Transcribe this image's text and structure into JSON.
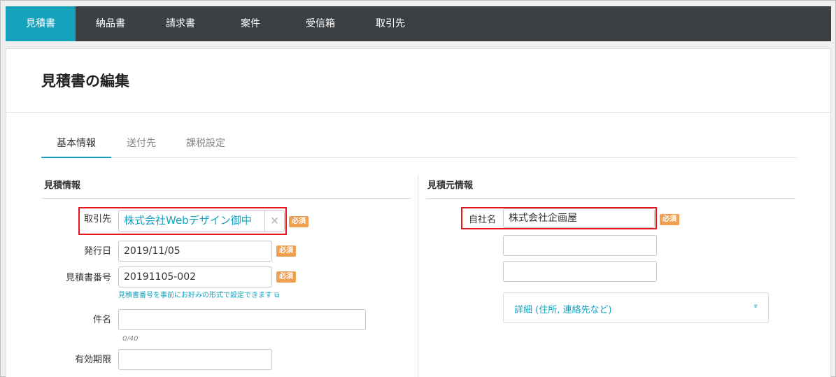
{
  "nav": {
    "items": [
      {
        "label": "見積書",
        "active": true
      },
      {
        "label": "納品書",
        "active": false
      },
      {
        "label": "請求書",
        "active": false
      },
      {
        "label": "案件",
        "active": false
      },
      {
        "label": "受信箱",
        "active": false
      },
      {
        "label": "取引先",
        "active": false
      }
    ]
  },
  "page": {
    "title": "見積書の編集"
  },
  "tabs": [
    {
      "label": "基本情報",
      "active": true
    },
    {
      "label": "送付先",
      "active": false
    },
    {
      "label": "課税設定",
      "active": false
    }
  ],
  "left": {
    "section_title": "見積情報",
    "client": {
      "label": "取引先",
      "value": "株式会社Webデザイン御中",
      "clear_icon": "×"
    },
    "issue_date": {
      "label": "発行日",
      "value": "2019/11/05"
    },
    "estimate_number": {
      "label": "見積書番号",
      "value": "20191105-002",
      "hint": "見積書番号を事前にお好みの形式で設定できます",
      "hint_icon": "⧉"
    },
    "subject": {
      "label": "件名",
      "value": "",
      "counter": "0/40"
    },
    "expiry": {
      "label": "有効期限",
      "value": ""
    }
  },
  "right": {
    "section_title": "見積元情報",
    "company": {
      "label": "自社名",
      "value": "株式会社企画屋"
    },
    "extra_line1": "",
    "extra_line2": "",
    "detail": {
      "label": "詳細 (住所, 連絡先など)",
      "chevron": "»"
    }
  },
  "required_badge": "必須",
  "colors": {
    "accent": "#15a2bd",
    "nav_bg": "#3c4043",
    "badge": "#f0a050",
    "highlight": "#e8141b"
  }
}
